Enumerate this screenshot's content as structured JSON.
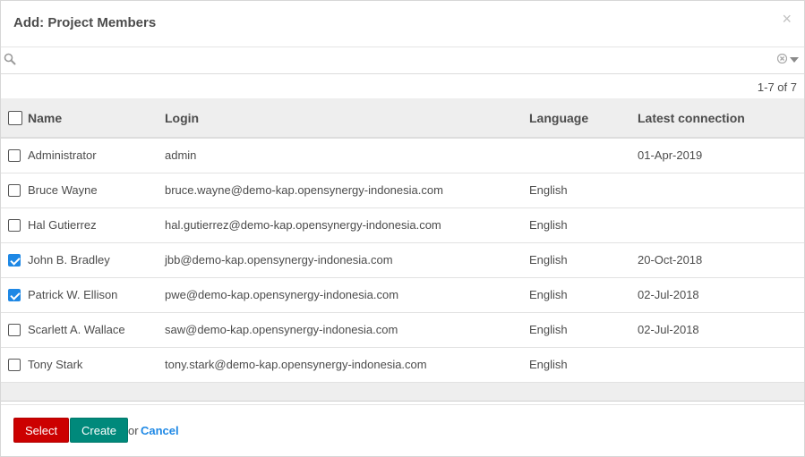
{
  "dialog": {
    "title": "Add: Project Members",
    "close_glyph": "×"
  },
  "search": {
    "value": "",
    "placeholder": ""
  },
  "pager": {
    "text": "1-7 of 7"
  },
  "table": {
    "columns": [
      "Name",
      "Login",
      "Language",
      "Latest connection"
    ],
    "rows": [
      {
        "name": "Administrator",
        "login": "admin",
        "language": "",
        "latest": "01-Apr-2019",
        "checked": false
      },
      {
        "name": "Bruce Wayne",
        "login": "bruce.wayne@demo-kap.opensynergy-indonesia.com",
        "language": "English",
        "latest": "",
        "checked": false
      },
      {
        "name": "Hal Gutierrez",
        "login": "hal.gutierrez@demo-kap.opensynergy-indonesia.com",
        "language": "English",
        "latest": "",
        "checked": false
      },
      {
        "name": "John B. Bradley",
        "login": "jbb@demo-kap.opensynergy-indonesia.com",
        "language": "English",
        "latest": "20-Oct-2018",
        "checked": true
      },
      {
        "name": "Patrick W. Ellison",
        "login": "pwe@demo-kap.opensynergy-indonesia.com",
        "language": "English",
        "latest": "02-Jul-2018",
        "checked": true
      },
      {
        "name": "Scarlett A. Wallace",
        "login": "saw@demo-kap.opensynergy-indonesia.com",
        "language": "English",
        "latest": "02-Jul-2018",
        "checked": false
      },
      {
        "name": "Tony Stark",
        "login": "tony.stark@demo-kap.opensynergy-indonesia.com",
        "language": "English",
        "latest": "",
        "checked": false
      }
    ]
  },
  "footer": {
    "select_label": "Select",
    "create_label": "Create",
    "or_text": "or",
    "cancel_label": "Cancel"
  },
  "colors": {
    "select_button": "#cc0000",
    "create_button": "#00897b",
    "link": "#1e88e5",
    "checkbox_checked": "#1e88e5",
    "header_background": "#eeeeee"
  },
  "icons": {
    "search": "search-icon",
    "clear": "clear-circle-icon",
    "dropdown": "caret-down-icon",
    "close": "close-icon"
  }
}
